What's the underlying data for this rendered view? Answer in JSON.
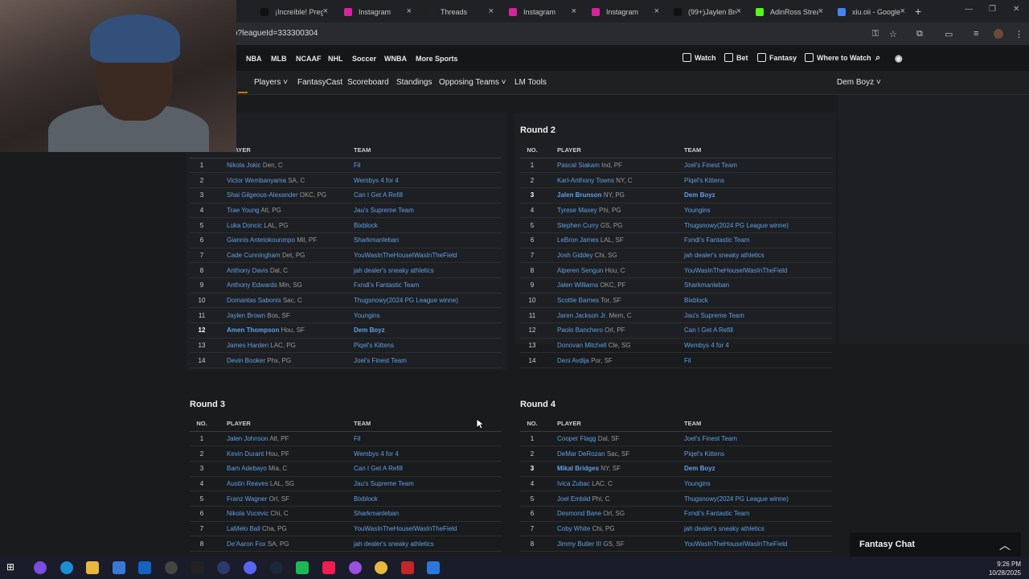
{
  "browser": {
    "tabs": [
      {
        "label": "¡Increíble! Preg",
        "icon": "tiktok-icon",
        "color": "#111111"
      },
      {
        "label": "Instagram",
        "icon": "instagram-icon",
        "color": "#d6249f"
      },
      {
        "label": "Threads",
        "icon": "threads-icon",
        "color": "#222222"
      },
      {
        "label": "Instagram",
        "icon": "instagram-icon",
        "color": "#d6249f"
      },
      {
        "label": "Instagram",
        "icon": "instagram-icon",
        "color": "#d6249f"
      },
      {
        "label": "(99+)Jaylen Bro",
        "icon": "tiktok-icon",
        "color": "#111111"
      },
      {
        "label": "AdinRoss Strea",
        "icon": "kick-icon",
        "color": "#53fc18"
      },
      {
        "label": "xiu.oii - Google",
        "icon": "google-icon",
        "color": "#4285f4"
      }
    ],
    "url": "o?leagueId=333300304"
  },
  "site_nav": {
    "sports": [
      "NBA",
      "MLB",
      "NCAAF",
      "NHL",
      "Soccer",
      "WNBA",
      "More Sports"
    ],
    "right": [
      "Watch",
      "Bet",
      "Fantasy",
      "Where to Watch"
    ]
  },
  "sub_nav": {
    "items": [
      "Players ˅",
      "FantasyCast",
      "Scoreboard",
      "Standings",
      "Opposing Teams ˅",
      "LM Tools"
    ],
    "team": "Dem Boyz ˅"
  },
  "columns": {
    "no": "NO.",
    "player": "PLAYER",
    "team": "TEAM"
  },
  "rounds": [
    {
      "title": "",
      "picks": [
        {
          "no": "1",
          "name": "Nikola Jokic",
          "info": "Den, C",
          "team": "Fil"
        },
        {
          "no": "2",
          "name": "Victor Wembanyama",
          "info": "SA, C",
          "team": "Wembys 4 for 4"
        },
        {
          "no": "3",
          "name": "Shai Gilgeous-Alexander",
          "info": "OKC, PG",
          "team": "Can I Get A Refill"
        },
        {
          "no": "4",
          "name": "Trae Young",
          "info": "Atl, PG",
          "team": "Jau's Supreme Team"
        },
        {
          "no": "5",
          "name": "Luka Doncic",
          "info": "LAL, PG",
          "team": "Bixblock"
        },
        {
          "no": "6",
          "name": "Giannis Antetokounmpo",
          "info": "Mil, PF",
          "team": "Sharkmanleban"
        },
        {
          "no": "7",
          "name": "Cade Cunningham",
          "info": "Det, PG",
          "team": "YouWasInTheHouseIWasInTheField"
        },
        {
          "no": "8",
          "name": "Anthony Davis",
          "info": "Dal, C",
          "team": "jah dealer's sneaky athletics"
        },
        {
          "no": "9",
          "name": "Anthony Edwards",
          "info": "Min, SG",
          "team": "Fxndi's Fantastic Team"
        },
        {
          "no": "10",
          "name": "Domantas Sabonis",
          "info": "Sac, C",
          "team": "Thugsnowy(2024 PG League winne)"
        },
        {
          "no": "11",
          "name": "Jaylen Brown",
          "info": "Bos, SF",
          "team": "Youngins"
        },
        {
          "no": "12",
          "name": "Amen Thompson",
          "info": "Hou, SF",
          "team": "Dem Boyz",
          "mine": true
        },
        {
          "no": "13",
          "name": "James Harden",
          "info": "LAC, PG",
          "team": "Piqel's Kittens"
        },
        {
          "no": "14",
          "name": "Devin Booker",
          "info": "Phx, PG",
          "team": "Joel's Finest Team"
        }
      ]
    },
    {
      "title": "Round 2",
      "picks": [
        {
          "no": "1",
          "name": "Pascal Siakam",
          "info": "Ind, PF",
          "team": "Joel's Finest Team"
        },
        {
          "no": "2",
          "name": "Karl-Anthony Towns",
          "info": "NY, C",
          "team": "Piqel's Kittens"
        },
        {
          "no": "3",
          "name": "Jalen Brunson",
          "info": "NY, PG",
          "team": "Dem Boyz",
          "mine": true
        },
        {
          "no": "4",
          "name": "Tyrese Maxey",
          "info": "Phi, PG",
          "team": "Youngins"
        },
        {
          "no": "5",
          "name": "Stephen Curry",
          "info": "GS, PG",
          "team": "Thugsnowy(2024 PG League winne)"
        },
        {
          "no": "6",
          "name": "LeBron James",
          "info": "LAL, SF",
          "team": "Fxndi's Fantastic Team"
        },
        {
          "no": "7",
          "name": "Josh Giddey",
          "info": "Chi, SG",
          "team": "jah dealer's sneaky athletics"
        },
        {
          "no": "8",
          "name": "Alperen Sengun",
          "info": "Hou, C",
          "team": "YouWasInTheHouseIWasInTheField"
        },
        {
          "no": "9",
          "name": "Jalen Williams",
          "info": "OKC, PF",
          "team": "Sharkmanleban"
        },
        {
          "no": "10",
          "name": "Scottie Barnes",
          "info": "Tor, SF",
          "team": "Bixblock"
        },
        {
          "no": "11",
          "name": "Jaren Jackson Jr.",
          "info": "Mem, C",
          "team": "Jau's Supreme Team"
        },
        {
          "no": "12",
          "name": "Paolo Banchero",
          "info": "Orl, PF",
          "team": "Can I Get A Refill"
        },
        {
          "no": "13",
          "name": "Donovan Mitchell",
          "info": "Cle, SG",
          "team": "Wembys 4 for 4"
        },
        {
          "no": "14",
          "name": "Deni Avdija",
          "info": "Por, SF",
          "team": "Fil"
        }
      ]
    },
    {
      "title": "Round 3",
      "picks": [
        {
          "no": "1",
          "name": "Jalen Johnson",
          "info": "Atl, PF",
          "team": "Fil"
        },
        {
          "no": "2",
          "name": "Kevin Durant",
          "info": "Hou, PF",
          "team": "Wembys 4 for 4"
        },
        {
          "no": "3",
          "name": "Bam Adebayo",
          "info": "Mia, C",
          "team": "Can I Get A Refill"
        },
        {
          "no": "4",
          "name": "Austin Reaves",
          "info": "LAL, SG",
          "team": "Jau's Supreme Team"
        },
        {
          "no": "5",
          "name": "Franz Wagner",
          "info": "Orl, SF",
          "team": "Bixblock"
        },
        {
          "no": "6",
          "name": "Nikola Vucevic",
          "info": "Chi, C",
          "team": "Sharkmanleban"
        },
        {
          "no": "7",
          "name": "LaMelo Ball",
          "info": "Cha, PG",
          "team": "YouWasInTheHouseIWasInTheField"
        },
        {
          "no": "8",
          "name": "De'Aaron Fox",
          "info": "SA, PG",
          "team": "jah dealer's sneaky athletics"
        }
      ]
    },
    {
      "title": "Round 4",
      "picks": [
        {
          "no": "1",
          "name": "Cooper Flagg",
          "info": "Dal, SF",
          "team": "Joel's Finest Team"
        },
        {
          "no": "2",
          "name": "DeMar DeRozan",
          "info": "Sac, SF",
          "team": "Piqel's Kittens"
        },
        {
          "no": "3",
          "name": "Mikal Bridges",
          "info": "NY, SF",
          "team": "Dem Boyz",
          "mine": true
        },
        {
          "no": "4",
          "name": "Ivica Zubac",
          "info": "LAC, C",
          "team": "Youngins"
        },
        {
          "no": "5",
          "name": "Joel Embiid",
          "info": "Phi, C",
          "team": "Thugsnowy(2024 PG League winne)"
        },
        {
          "no": "6",
          "name": "Desmond Bane",
          "info": "Orl, SG",
          "team": "Fxndi's Fantastic Team"
        },
        {
          "no": "7",
          "name": "Coby White",
          "info": "Chi, PG",
          "team": "jah dealer's sneaky athletics"
        },
        {
          "no": "8",
          "name": "Jimmy Butler III",
          "info": "GS, SF",
          "team": "YouWasInTheHouseIWasInTheField"
        }
      ]
    }
  ],
  "chat": {
    "label": "Fantasy Chat"
  },
  "taskbar": {
    "time": "9:26 PM",
    "date": "10/28/2025"
  },
  "colors": {
    "link": "#5ea0e8",
    "accent": "#b87800",
    "background": "#1a1b1d"
  }
}
